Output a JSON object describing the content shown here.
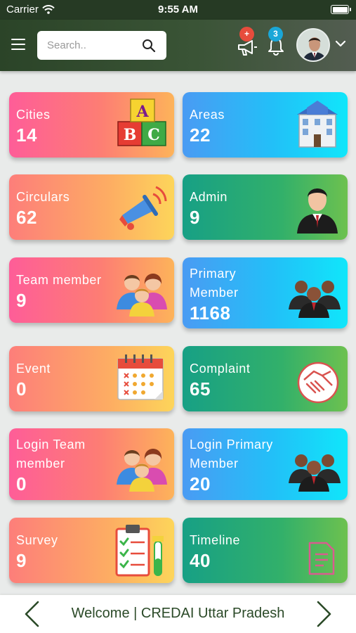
{
  "status_bar": {
    "carrier": "Carrier",
    "time": "9:55 AM"
  },
  "header": {
    "search": {
      "placeholder": "Search.."
    },
    "announcement_badge": "+",
    "notification_badge": "3"
  },
  "tiles": [
    {
      "label": "Cities",
      "value": "14",
      "icon": "abc-blocks-icon"
    },
    {
      "label": "Areas",
      "value": "22",
      "icon": "building-icon"
    },
    {
      "label": "Circulars",
      "value": "62",
      "icon": "megaphone-icon"
    },
    {
      "label": "Admin",
      "value": "9",
      "icon": "businessman-icon"
    },
    {
      "label": "Team member",
      "value": "9",
      "icon": "family-group-icon"
    },
    {
      "label": "Primary Member",
      "value": "1168",
      "icon": "members-group-icon"
    },
    {
      "label": "Event",
      "value": "0",
      "icon": "calendar-icon"
    },
    {
      "label": "Complaint",
      "value": "65",
      "icon": "handshake-icon"
    },
    {
      "label": "Login Team member",
      "value": "0",
      "icon": "family-group-icon"
    },
    {
      "label": "Login Primary Member",
      "value": "20",
      "icon": "members-group-icon"
    },
    {
      "label": "Survey",
      "value": "9",
      "icon": "clipboard-checklist-icon"
    },
    {
      "label": "Timeline",
      "value": "40",
      "icon": "document-icon"
    }
  ],
  "footer": {
    "welcome_text": "Welcome | CREDAI Uttar Pradesh"
  },
  "colors": {
    "header_green": "#2b4428",
    "pink": "#fe5d98",
    "orange": "#fdac63",
    "blue": "#22c0f8",
    "green": "#32b06a"
  }
}
